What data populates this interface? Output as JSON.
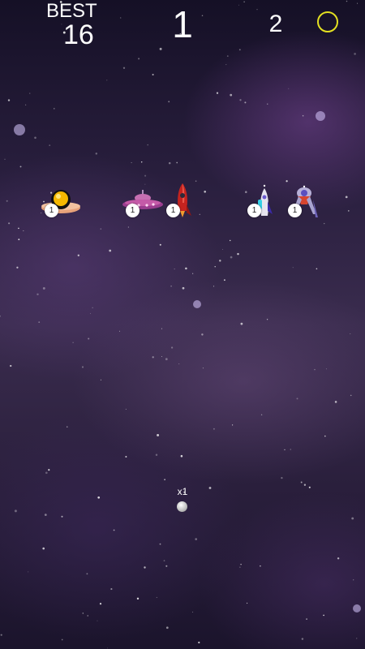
{
  "hud": {
    "best_label": "BEST",
    "best_value": "16",
    "score": "1",
    "coins": "2",
    "coin_icon": "coin-ring-icon",
    "coin_color": "#e3e021"
  },
  "enemies": [
    {
      "name": "yellow-dome-ufo",
      "icon": "ufo-dome-icon",
      "hp": "1"
    },
    {
      "name": "purple-saucer",
      "icon": "saucer-icon",
      "hp": "1"
    },
    {
      "name": "red-rocket",
      "icon": "rocket-icon",
      "hp": "1"
    },
    {
      "name": "white-shuttle",
      "icon": "shuttle-icon",
      "hp": "1"
    },
    {
      "name": "silver-lander",
      "icon": "lander-icon",
      "hp": "1"
    }
  ],
  "ball": {
    "multiplier": "x1"
  }
}
